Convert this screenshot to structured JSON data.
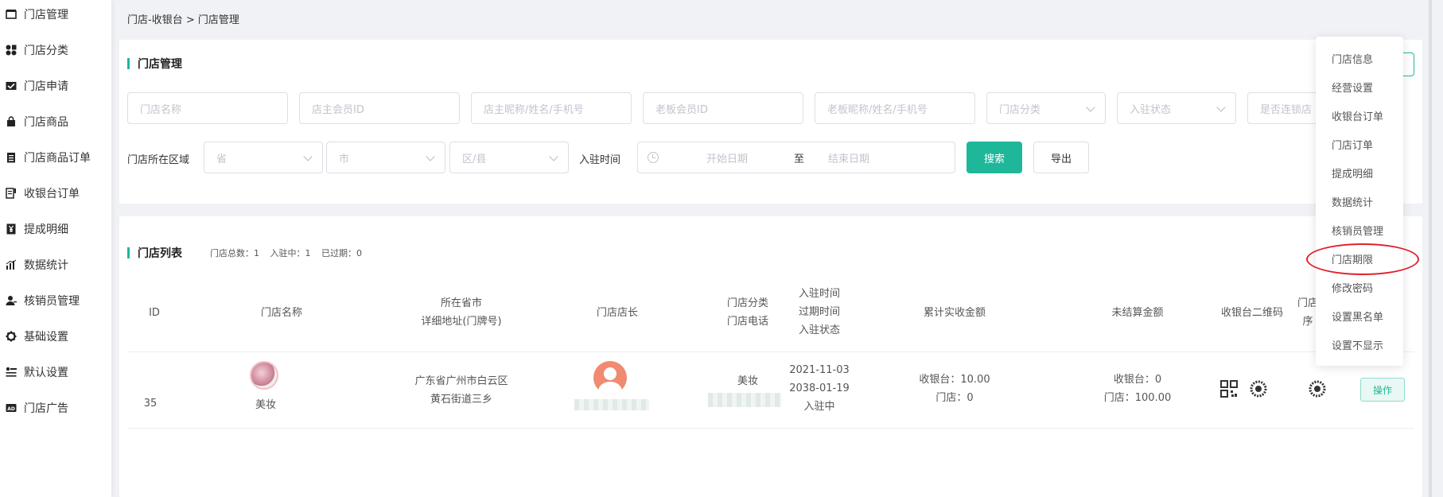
{
  "sidebar": {
    "items": [
      {
        "label": "门店管理",
        "icon": "store-icon"
      },
      {
        "label": "门店分类",
        "icon": "category-icon"
      },
      {
        "label": "门店申请",
        "icon": "inbox-icon"
      },
      {
        "label": "门店商品",
        "icon": "bag-icon"
      },
      {
        "label": "门店商品订单",
        "icon": "clipboard-icon"
      },
      {
        "label": "收银台订单",
        "icon": "receipt-icon"
      },
      {
        "label": "提成明细",
        "icon": "currency-icon"
      },
      {
        "label": "数据统计",
        "icon": "chart-icon"
      },
      {
        "label": "核销员管理",
        "icon": "user-icon"
      },
      {
        "label": "基础设置",
        "icon": "gear-icon"
      },
      {
        "label": "默认设置",
        "icon": "settings-list-icon"
      },
      {
        "label": "门店广告",
        "icon": "ad-icon"
      }
    ]
  },
  "breadcrumb": "门店-收银台 > 门店管理",
  "filter": {
    "title": "门店管理",
    "placeholders": {
      "store_name": "门店名称",
      "owner_member_id": "店主会员ID",
      "owner_contact": "店主昵称/姓名/手机号",
      "boss_member_id": "老板会员ID",
      "boss_contact": "老板昵称/姓名/手机号",
      "store_category": "门店分类",
      "join_status": "入驻状态",
      "is_chain": "是否连锁店",
      "province": "省",
      "city": "市",
      "district": "区/县",
      "start_date": "开始日期",
      "end_date": "结束日期"
    },
    "region_label": "门店所在区域",
    "join_time_label": "入驻时间",
    "range_separator": "至",
    "search_button": "搜索",
    "export_button": "导出"
  },
  "list": {
    "title": "门店列表",
    "stats": {
      "total": "门店总数：1",
      "active": "入驻中：1",
      "expired": "已过期：0"
    },
    "columns": {
      "id": "ID",
      "name": "门店名称",
      "address_1": "所在省市",
      "address_2": "详细地址(门牌号)",
      "manager": "门店店长",
      "cat_1": "门店分类",
      "cat_2": "门店电话",
      "time_1": "入驻时间",
      "time_2": "过期时间",
      "time_3": "入驻状态",
      "received": "累计实收金额",
      "unsettled": "未结算金额",
      "qrcode": "收银台二维码",
      "store_1": "门店",
      "store_2": "序"
    },
    "rows": [
      {
        "id": "35",
        "name": "美妆",
        "address_line1": "广东省广州市白云区",
        "address_line2": "黄石街道三乡",
        "category": "美妆",
        "join_time": "2021-11-03",
        "expire_time": "2038-01-19",
        "status": "入驻中",
        "received_cashier": "收银台：10.00",
        "received_store": "门店：0",
        "unsettled_cashier": "收银台：0",
        "unsettled_store": "门店：100.00",
        "operate": "操作"
      }
    ]
  },
  "dropdown": {
    "items": [
      "门店信息",
      "经营设置",
      "收银台订单",
      "门店订单",
      "提成明细",
      "数据统计",
      "核销员管理",
      "门店期限",
      "修改密码",
      "设置黑名单",
      "设置不显示"
    ]
  },
  "colors": {
    "accent": "#1fb79a",
    "highlight": "#e0202a"
  }
}
